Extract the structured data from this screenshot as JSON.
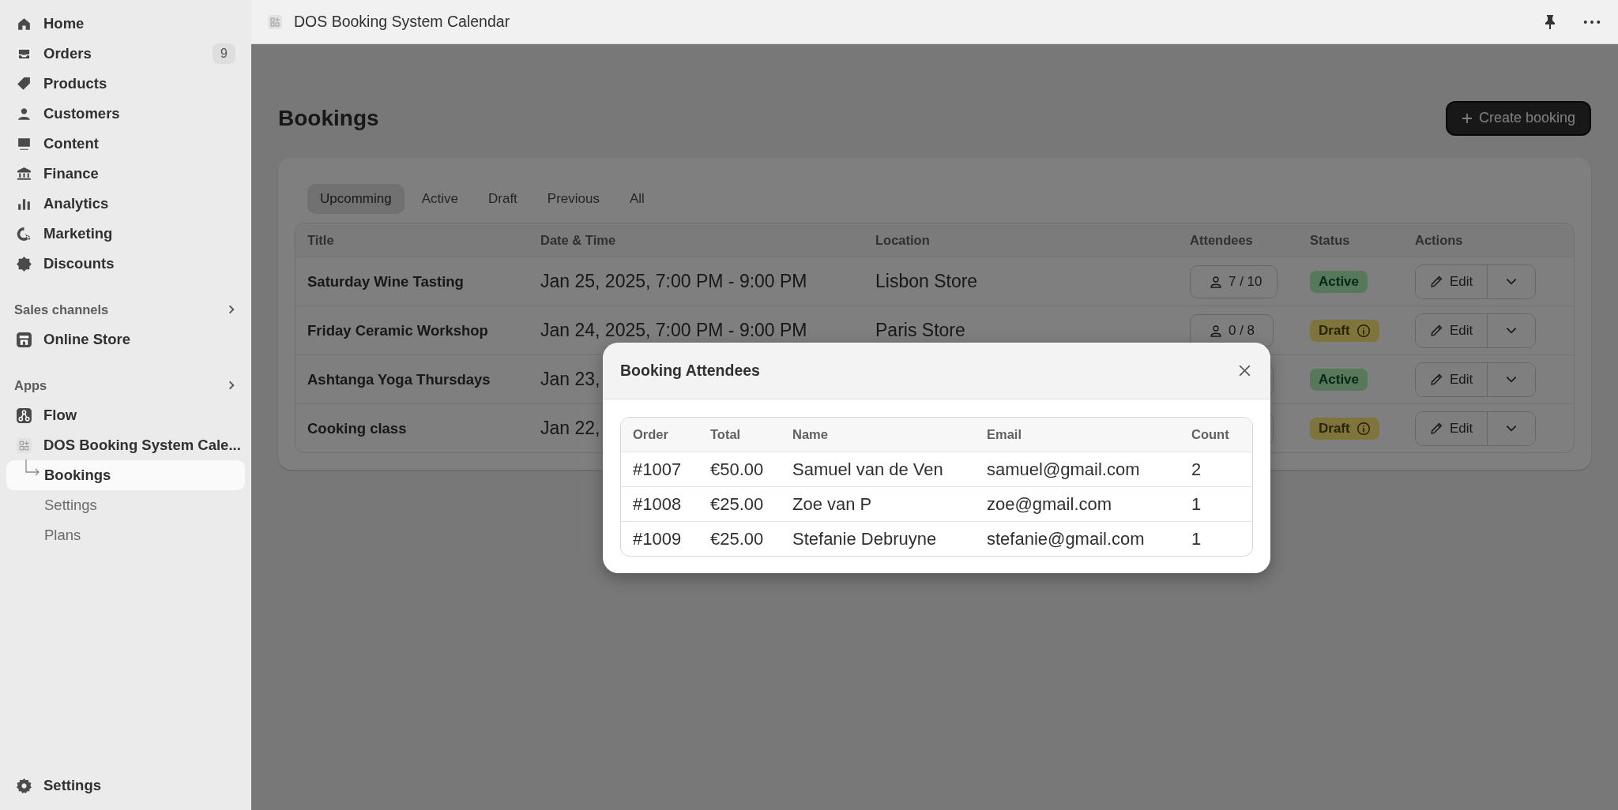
{
  "sidebar": {
    "items": [
      {
        "label": "Home",
        "selected": false
      },
      {
        "label": "Orders",
        "badge": "9",
        "selected": false
      },
      {
        "label": "Products",
        "selected": false
      },
      {
        "label": "Customers",
        "selected": false
      },
      {
        "label": "Content",
        "selected": false
      },
      {
        "label": "Finance",
        "selected": false
      },
      {
        "label": "Analytics",
        "selected": false
      },
      {
        "label": "Marketing",
        "selected": false
      },
      {
        "label": "Discounts",
        "selected": false
      }
    ],
    "sales_channels": {
      "heading": "Sales channels",
      "items": [
        {
          "label": "Online Store",
          "selected": false
        }
      ]
    },
    "apps": {
      "heading": "Apps",
      "items": [
        {
          "label": "Flow",
          "selected": false
        },
        {
          "label": "DOS Booking System Cale...",
          "selected": false,
          "children": [
            {
              "label": "Bookings",
              "selected": true
            },
            {
              "label": "Settings",
              "selected": false
            },
            {
              "label": "Plans",
              "selected": false
            }
          ]
        }
      ]
    },
    "footer": {
      "label": "Settings",
      "selected": false
    }
  },
  "topbar": {
    "title": "DOS Booking System Calendar"
  },
  "page": {
    "title": "Bookings",
    "primary_action": "Create booking"
  },
  "tabs": [
    {
      "label": "Upcomming",
      "selected": true
    },
    {
      "label": "Active",
      "selected": false
    },
    {
      "label": "Draft",
      "selected": false
    },
    {
      "label": "Previous",
      "selected": false
    },
    {
      "label": "All",
      "selected": false
    }
  ],
  "table": {
    "columns": [
      "Title",
      "Date & Time",
      "Location",
      "Attendees",
      "Status",
      "Actions"
    ],
    "rows": [
      {
        "title": "Saturday Wine Tasting",
        "date_time": "Jan 25, 2025, 7:00 PM - 9:00 PM",
        "location": "Lisbon Store",
        "attendees": "7 / 10",
        "status": {
          "label": "Active",
          "kind": "active"
        },
        "action": "Edit"
      },
      {
        "title": "Friday Ceramic Workshop",
        "date_time": "Jan 24, 2025, 7:00 PM - 9:00 PM",
        "location": "Paris Store",
        "attendees": "0 / 8",
        "status": {
          "label": "Draft",
          "kind": "draft"
        },
        "action": "Edit"
      },
      {
        "title": "Ashtanga Yoga Thursdays",
        "date_time": "Jan 23,",
        "status": {
          "label": "Active",
          "kind": "active"
        },
        "action": "Edit"
      },
      {
        "title": "Cooking class",
        "date_time": "Jan 22,",
        "status": {
          "label": "Draft",
          "kind": "draft"
        },
        "action": "Edit"
      }
    ]
  },
  "modal": {
    "title": "Booking Attendees",
    "columns": [
      "Order",
      "Total",
      "Name",
      "Email",
      "Count"
    ],
    "rows": [
      {
        "order": "#1007",
        "total": "€50.00",
        "name": "Samuel van de Ven",
        "email": "samuel@gmail.com",
        "count": "2"
      },
      {
        "order": "#1008",
        "total": "€25.00",
        "name": "Zoe van P",
        "email": "zoe@gmail.com",
        "count": "1"
      },
      {
        "order": "#1009",
        "total": "€25.00",
        "name": "Stefanie Debruyne",
        "email": "stefanie@gmail.com",
        "count": "1"
      }
    ]
  }
}
